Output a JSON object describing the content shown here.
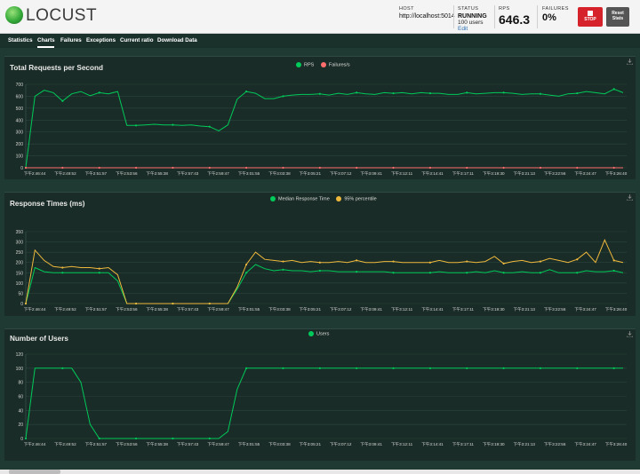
{
  "app": {
    "name": "LOCUST"
  },
  "header": {
    "host_label": "HOST",
    "host_value": "http://localhost:5014",
    "status_label": "STATUS",
    "status_value": "RUNNING",
    "users_text": "100 users",
    "edit_label": "Edit",
    "rps_label": "RPS",
    "rps_value": "646.3",
    "failures_label": "FAILURES",
    "failures_value": "0%",
    "stop_label": "STOP",
    "reset_label_1": "Reset",
    "reset_label_2": "Stats"
  },
  "tabs": [
    {
      "label": "Statistics"
    },
    {
      "label": "Charts"
    },
    {
      "label": "Failures"
    },
    {
      "label": "Exceptions"
    },
    {
      "label": "Current ratio"
    },
    {
      "label": "Download Data"
    }
  ],
  "active_tab": "Charts",
  "colors": {
    "green": "#00ca5a",
    "red": "#ff6d6d",
    "yellow": "#eeb83c",
    "accent": "#d6222b"
  },
  "time_ticks": [
    "下午2:46:44",
    "下午2:49:52",
    "下午2:51:57",
    "下午2:53:56",
    "下午2:55:38",
    "下午2:57:43",
    "下午2:59:47",
    "下午3:01:55",
    "下午3:03:38",
    "下午3:05:21",
    "下午3:07:12",
    "下午3:09:41",
    "下午3:12:11",
    "下午3:14:41",
    "下午3:17:11",
    "下午3:19:30",
    "下午3:21:13",
    "下午3:22:56",
    "下午3:24:47",
    "下午3:26:40"
  ],
  "chart_data": [
    {
      "type": "line",
      "title": "Total Requests per Second",
      "ylim": [
        0,
        700
      ],
      "yticks": [
        "0",
        "100",
        "200",
        "300",
        "400",
        "500",
        "600",
        "700"
      ],
      "series": [
        {
          "name": "RPS",
          "values": [
            0,
            600,
            650,
            630,
            560,
            620,
            640,
            605,
            630,
            620,
            640,
            355,
            355,
            360,
            365,
            360,
            360,
            355,
            360,
            350,
            345,
            310,
            360,
            575,
            640,
            625,
            580,
            580,
            600,
            610,
            615,
            615,
            620,
            610,
            625,
            615,
            630,
            620,
            615,
            630,
            625,
            630,
            620,
            630,
            625,
            625,
            615,
            615,
            630,
            620,
            625,
            630,
            630,
            625,
            615,
            620,
            620,
            610,
            600,
            620,
            625,
            640,
            630,
            620,
            660,
            630
          ]
        },
        {
          "name": "Failures/s",
          "values": [
            0,
            0,
            0,
            0,
            0,
            0,
            0,
            0,
            0,
            0,
            0,
            0,
            0,
            0,
            0,
            0,
            0,
            0,
            0,
            0,
            0,
            0,
            0,
            0,
            0,
            0,
            0,
            0,
            0,
            0,
            0,
            0,
            0,
            0,
            0,
            0,
            0,
            0,
            0,
            0,
            0,
            0,
            0,
            0,
            0,
            0,
            0,
            0,
            0,
            0,
            0,
            0,
            0,
            0,
            0,
            0,
            0,
            0,
            0,
            0,
            0,
            0,
            0,
            0,
            0,
            0
          ]
        }
      ]
    },
    {
      "type": "line",
      "title": "Response Times (ms)",
      "ylim": [
        0,
        350
      ],
      "yticks": [
        "0",
        "50",
        "100",
        "150",
        "200",
        "250",
        "300",
        "350"
      ],
      "series": [
        {
          "name": "Median Response Time",
          "values": [
            0,
            175,
            155,
            150,
            150,
            150,
            150,
            150,
            150,
            150,
            110,
            0,
            0,
            0,
            0,
            0,
            0,
            0,
            0,
            0,
            0,
            0,
            0,
            70,
            150,
            190,
            170,
            160,
            165,
            160,
            160,
            155,
            160,
            160,
            155,
            155,
            155,
            155,
            155,
            155,
            150,
            150,
            150,
            150,
            150,
            155,
            150,
            150,
            150,
            155,
            150,
            160,
            150,
            150,
            155,
            150,
            150,
            165,
            150,
            150,
            150,
            160,
            155,
            155,
            160,
            150
          ]
        },
        {
          "name": "95% percentile",
          "values": [
            0,
            260,
            210,
            180,
            175,
            180,
            175,
            175,
            170,
            175,
            140,
            0,
            0,
            0,
            0,
            0,
            0,
            0,
            0,
            0,
            0,
            0,
            0,
            80,
            190,
            250,
            215,
            210,
            205,
            210,
            200,
            205,
            200,
            200,
            205,
            200,
            210,
            200,
            200,
            205,
            205,
            200,
            200,
            200,
            200,
            210,
            200,
            200,
            205,
            200,
            205,
            230,
            195,
            205,
            210,
            200,
            205,
            220,
            210,
            200,
            215,
            250,
            200,
            310,
            210,
            200
          ]
        }
      ]
    },
    {
      "type": "line",
      "title": "Number of Users",
      "ylim": [
        0,
        120
      ],
      "yticks": [
        "0",
        "20",
        "40",
        "60",
        "80",
        "100",
        "120"
      ],
      "series": [
        {
          "name": "Users",
          "values": [
            0,
            100,
            100,
            100,
            100,
            100,
            80,
            20,
            0,
            0,
            0,
            0,
            0,
            0,
            0,
            0,
            0,
            0,
            0,
            0,
            0,
            0,
            10,
            70,
            100,
            100,
            100,
            100,
            100,
            100,
            100,
            100,
            100,
            100,
            100,
            100,
            100,
            100,
            100,
            100,
            100,
            100,
            100,
            100,
            100,
            100,
            100,
            100,
            100,
            100,
            100,
            100,
            100,
            100,
            100,
            100,
            100,
            100,
            100,
            100,
            100,
            100,
            100,
            100,
            100,
            100
          ]
        }
      ]
    }
  ]
}
